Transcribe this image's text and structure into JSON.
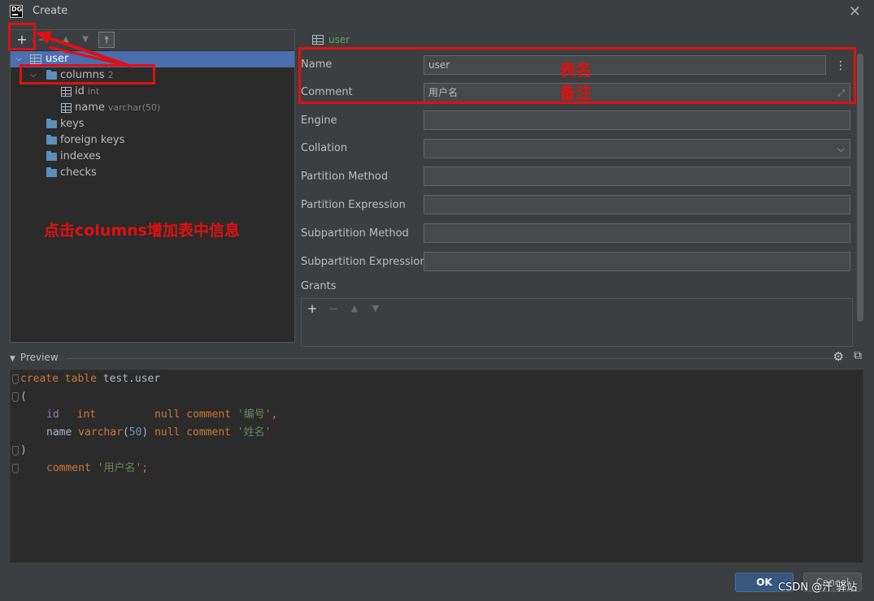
{
  "window": {
    "title": "Create",
    "logo_text": "DG"
  },
  "tree_toolbar": {
    "add": "+",
    "remove": "−",
    "up": "▲",
    "down": "▼",
    "move_out": "⤒"
  },
  "tree": {
    "root": {
      "label": "user"
    },
    "columns": {
      "label": "columns",
      "count": "2"
    },
    "column_items": [
      {
        "label": "id",
        "type": "int"
      },
      {
        "label": "name",
        "type": "varchar(50)"
      }
    ],
    "folders": [
      "keys",
      "foreign keys",
      "indexes",
      "checks"
    ]
  },
  "form": {
    "header": "user",
    "fields": [
      {
        "label": "Name",
        "value": "user"
      },
      {
        "label": "Comment",
        "value": "用户名"
      },
      {
        "label": "Engine",
        "value": ""
      },
      {
        "label": "Collation",
        "value": ""
      },
      {
        "label": "Partition Method",
        "value": ""
      },
      {
        "label": "Partition Expression",
        "value": ""
      },
      {
        "label": "Subpartition Method",
        "value": ""
      },
      {
        "label": "Subpartition Expression",
        "value": ""
      }
    ],
    "grants_label": "Grants"
  },
  "preview": {
    "title": "Preview",
    "code": {
      "l1": {
        "k": "create table ",
        "t": "test.user"
      },
      "l2": "(",
      "l3": {
        "col": "id",
        "type": "int",
        "null_kw": "null comment ",
        "comment": "'编号'",
        "comma": ","
      },
      "l4": {
        "col": "name",
        "type": "varchar",
        "p1": "(",
        "num": "50",
        "p2": ")",
        "null_kw": " null comment ",
        "comment": "'姓名'"
      },
      "l5": ")",
      "l6": {
        "k": "comment ",
        "comment": "'用户名'",
        "semi": ";"
      }
    }
  },
  "buttons": {
    "ok": "OK",
    "cancel": "Cancel"
  },
  "watermark": "CSDN @汗 驿站",
  "annotations": {
    "table_name": "表名",
    "comment": "备注",
    "click_hint": "点击columns增加表中信息"
  },
  "colors": {
    "accent": "#e01010",
    "selection": "#4b6eaf",
    "ok": "#365880"
  }
}
